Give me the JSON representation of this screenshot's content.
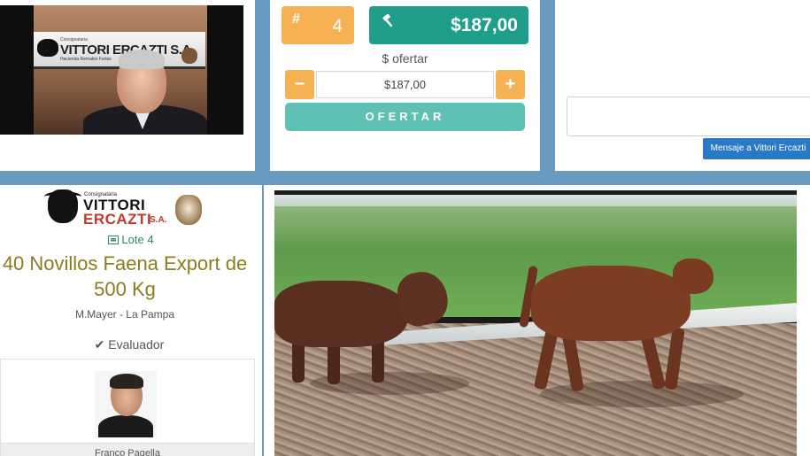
{
  "video": {
    "banner_pre": "Consignataria",
    "banner_name": "VITTORI ERCAZTI S.A.",
    "banner_sub": "Hacienda  Remates  Ferias"
  },
  "bid": {
    "lot_symbol": "#",
    "lot_number": "4",
    "current_price": "$187,00",
    "offer_label": "$ ofertar",
    "offer_value": "$187,00",
    "minus": "−",
    "plus": "+",
    "offer_button": "OFERTAR"
  },
  "message": {
    "placeholder": "",
    "button": "Mensaje a Vittori Ercazti"
  },
  "lot": {
    "logo_pre": "Consignataria",
    "logo_line1": "VITTORI",
    "logo_line2": "ERCAZTI",
    "logo_sa": "S.A.",
    "lote_label": "Lote 4",
    "title": "40 Novillos Faena Export de 500 Kg",
    "location": "M.Mayer - La Pampa",
    "evaluator_label": "✔ Evaluador",
    "evaluator_name": "Franco Pagella"
  },
  "colors": {
    "orange": "#f6b153",
    "teal": "#1f9e89",
    "teal_light": "#5fc1b4",
    "blue_button": "#2a79c4",
    "title_olive": "#8a7d1d",
    "lote_green": "#2d8a5e"
  },
  "icons": [
    "hash-icon",
    "gavel-icon",
    "minus-icon",
    "plus-icon",
    "list-icon",
    "check-icon"
  ]
}
